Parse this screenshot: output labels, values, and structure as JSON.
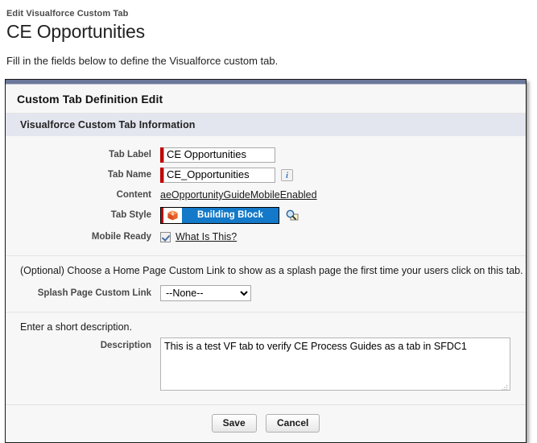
{
  "header": {
    "breadcrumb": "Edit Visualforce Custom Tab",
    "title": "CE Opportunities",
    "intro": "Fill in the fields below to define the Visualforce custom tab."
  },
  "panel": {
    "section_title": "Custom Tab Definition Edit",
    "subsection_title": "Visualforce Custom Tab Information"
  },
  "fields": {
    "tab_label": {
      "label": "Tab Label",
      "value": "CE Opportunities",
      "required": true
    },
    "tab_name": {
      "label": "Tab Name",
      "value": "CE_Opportunities",
      "required": true,
      "info_icon": "info-icon",
      "info_glyph": "i"
    },
    "content": {
      "label": "Content",
      "link_text": "aeOpportunityGuideMobileEnabled"
    },
    "tab_style": {
      "label": "Tab Style",
      "style_name": "Building Block",
      "icon": "building-block-icon",
      "lookup_icon": "magnifier-lookup-icon",
      "accent_color": "#1379c8",
      "icon_color": "#e8622a"
    },
    "mobile_ready": {
      "label": "Mobile Ready",
      "checked": true,
      "link_text": "What Is This?"
    }
  },
  "splash": {
    "helper_text": "(Optional) Choose a Home Page Custom Link to show as a splash page the first time your users click on this tab.",
    "label": "Splash Page Custom Link",
    "selected": "--None--",
    "options": [
      "--None--"
    ]
  },
  "description": {
    "helper_text": "Enter a short description.",
    "label": "Description",
    "value": "This is a test VF tab to verify CE Process Guides as a tab in SFDC1"
  },
  "buttons": {
    "save": "Save",
    "cancel": "Cancel"
  },
  "colors": {
    "required_bar": "#c00000",
    "panel_topbar": "#6b7899",
    "subsection_bg": "#e3e6ef",
    "tab_style_blue": "#1379c8"
  }
}
